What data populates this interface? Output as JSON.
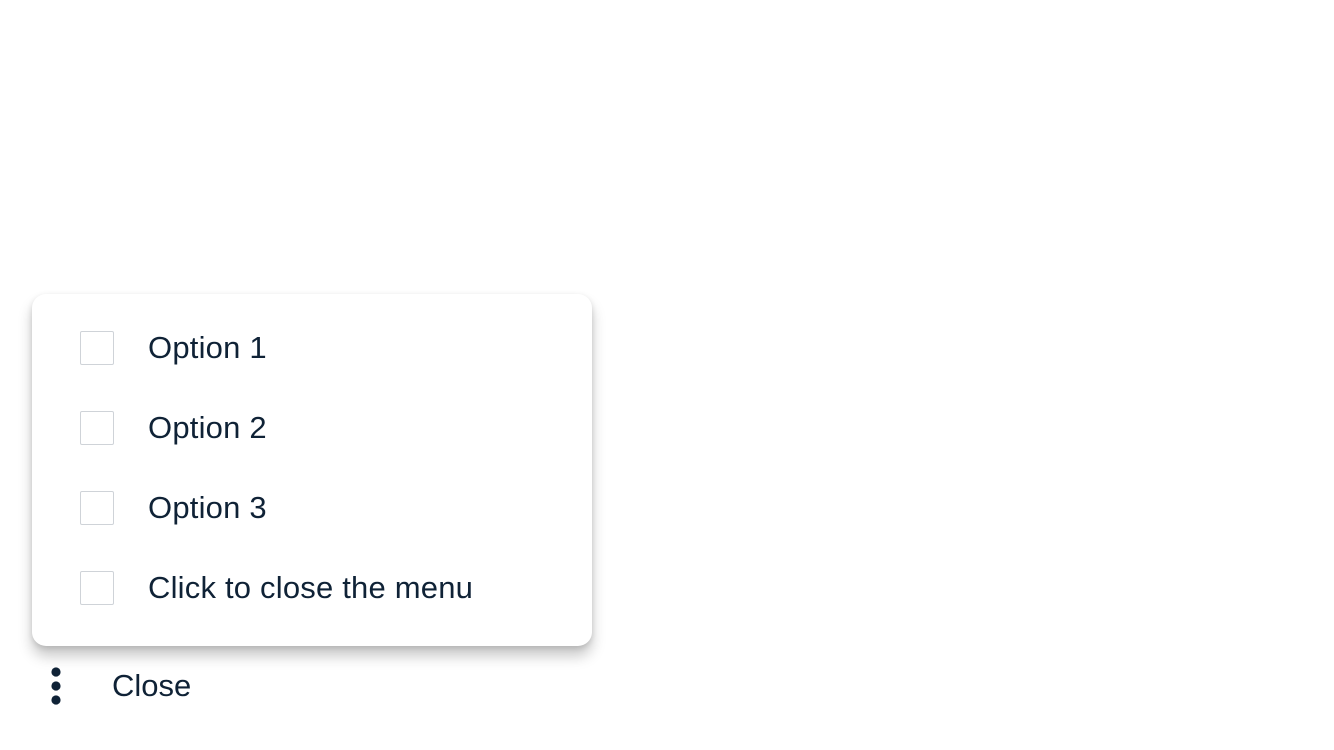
{
  "menu": {
    "items": [
      {
        "label": "Option 1",
        "checked": false
      },
      {
        "label": "Option 2",
        "checked": false
      },
      {
        "label": "Option 3",
        "checked": false
      },
      {
        "label": "Click to close the menu",
        "checked": false
      }
    ]
  },
  "trigger": {
    "icon": "more-vertical-icon",
    "label": "Close"
  },
  "colors": {
    "text": "#0f2236",
    "checkbox_border": "#cfd3d8",
    "background": "#ffffff"
  }
}
